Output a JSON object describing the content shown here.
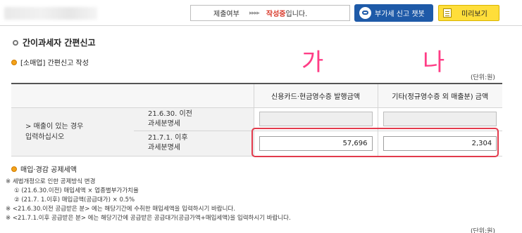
{
  "header": {
    "status_label": "제출여부",
    "status_arrows": "▸▸▸▸",
    "status_value": "작성중",
    "status_suffix": "입니다.",
    "chatbot_button": "부가세 신고 챗봇",
    "preview_button": "미리보기"
  },
  "page": {
    "title": "간이과세자 간편신고",
    "section1_title": "[소매업] 간편신고 작성",
    "annotation_left": "가",
    "annotation_right": "나",
    "unit_label": "(단위:원)"
  },
  "table": {
    "col_card": "신용카드·현금영수증 발행금액",
    "col_other": "기타(정규영수증 외 매출분) 금액",
    "side_label_line1": "> 매출이 있는 경우",
    "side_label_line2": "입력하십시오",
    "rows": [
      {
        "period_line1": "21.6.30. 이전",
        "period_line2": "과세분명세",
        "card_value": "",
        "other_value": ""
      },
      {
        "period_line1": "21.7.1. 이후",
        "period_line2": "과세분명세",
        "card_value": "57,696",
        "other_value": "2,304"
      }
    ]
  },
  "section2": {
    "title": "매입·경감 공제세액",
    "notes": [
      "※ 세법개정으로 인한 공제방식 변경",
      "① (21.6.30.이전) 매입세액 × 업종별부가가치율",
      "② (21.7. 1.이후) 매입금액(공급대가) × 0.5%",
      "※ <21.6.30.이전 공급받은 분> 에는 해당기간에 수취한 매입세액을 입력하시기 바랍니다.",
      "※ <21.7.1.이후 공급받은 분> 에는 해당기간에 공급받은 공급대가(공급가액+매입세액)을 입력하시기 바랍니다."
    ],
    "unit_label": "(단위:원)"
  },
  "colors": {
    "status_red": "#d93a2b",
    "chatbot_blue": "#1e5aa8",
    "preview_yellow": "#ffde3a",
    "annotation_pink": "#ff3d86",
    "highlight_red": "#e23a4c",
    "bullet_orange": "#f3a21a"
  }
}
